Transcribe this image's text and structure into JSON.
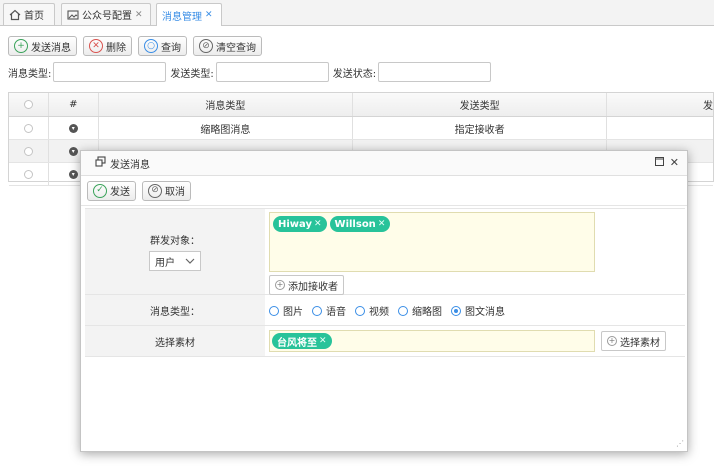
{
  "tabs": [
    {
      "label": "首页",
      "icon": "home-icon",
      "closable": false
    },
    {
      "label": "公众号配置",
      "icon": "image-icon",
      "closable": true
    },
    {
      "label": "消息管理",
      "icon": "",
      "closable": true
    }
  ],
  "toolbar": {
    "send": "发送消息",
    "delete": "删除",
    "query": "查询",
    "clear": "清空查询"
  },
  "filters": {
    "msg_type_label": "消息类型:",
    "send_type_label": "发送类型:",
    "send_status_label": "发送状态:"
  },
  "grid": {
    "columns": [
      "#",
      "消息类型",
      "发送类型",
      "发"
    ],
    "rows": [
      {
        "msg_type": "缩略图消息",
        "send_type": "指定接收者"
      },
      {
        "msg_type": "",
        "send_type": ""
      },
      {
        "msg_type": "",
        "send_type": ""
      }
    ]
  },
  "dialog": {
    "title": "发送消息",
    "send_btn": "发送",
    "cancel_btn": "取消",
    "target_label": "群发对象：",
    "target_select": "用户",
    "target_tags": [
      "Hiway",
      "Willson"
    ],
    "add_receiver": "添加接收者",
    "msg_type_label": "消息类型：",
    "msg_types": [
      {
        "label": "图片",
        "checked": false
      },
      {
        "label": "语音",
        "checked": false
      },
      {
        "label": "视频",
        "checked": false
      },
      {
        "label": "缩略图",
        "checked": false
      },
      {
        "label": "图文消息",
        "checked": true
      }
    ],
    "material_label": "选择素材",
    "material_tags": [
      "台风将至"
    ],
    "select_material": "选择素材"
  },
  "colors": {
    "accent": "#3a8ee6",
    "tag": "#28c39a",
    "tagbox": "#fffde9"
  }
}
